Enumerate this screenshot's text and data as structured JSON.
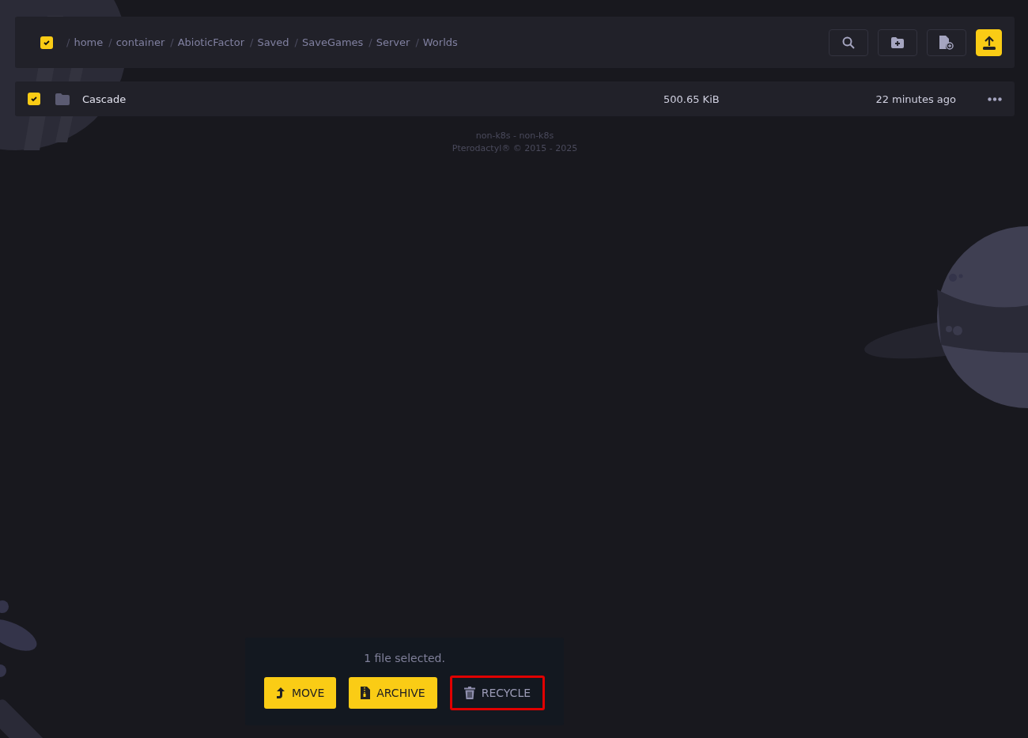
{
  "breadcrumb": {
    "checked": true,
    "separator": "/",
    "segments": [
      "home",
      "container",
      "AbioticFactor",
      "Saved",
      "SaveGames",
      "Server",
      "Worlds"
    ]
  },
  "toolbar": [
    {
      "kind": "search",
      "primary": false
    },
    {
      "kind": "new-folder",
      "primary": false
    },
    {
      "kind": "new-file",
      "primary": false
    },
    {
      "kind": "upload",
      "primary": true
    }
  ],
  "files": [
    {
      "kind": "folder",
      "name": "Cascade",
      "size": "500.65 KiB",
      "modified": "22 minutes ago",
      "checked": true
    }
  ],
  "footer": [
    "non-k8s - non-k8s",
    "Pterodactyl® © 2015 - 2025"
  ],
  "selection_bar": {
    "text": "1 file selected.",
    "actions": [
      {
        "kind": "move",
        "label": "MOVE",
        "primary": true,
        "highlighted": false
      },
      {
        "kind": "archive",
        "label": "ARCHIVE",
        "primary": true,
        "highlighted": false
      },
      {
        "kind": "recycle",
        "label": "RECYCLE",
        "primary": false,
        "highlighted": true
      }
    ]
  }
}
